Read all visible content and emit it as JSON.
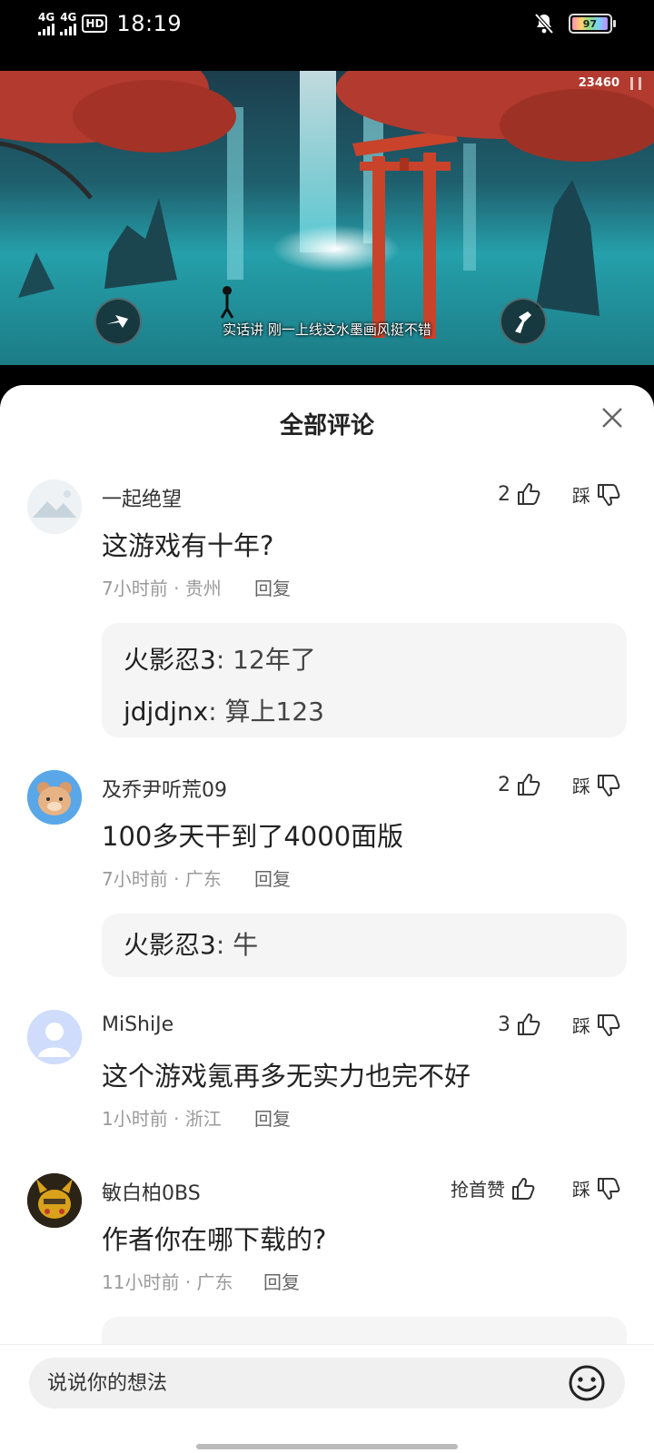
{
  "status_bar": {
    "signal1": "4G",
    "signal2": "4G",
    "hd": "HD",
    "time": "18:19",
    "battery": "97"
  },
  "video": {
    "score": "23460",
    "subtitle": "实话讲 刚一上线这水墨画风挺不错"
  },
  "sheet": {
    "title": "全部评论"
  },
  "comments": [
    {
      "user": "一起绝望",
      "text": "这游戏有十年?",
      "time": "7小时前",
      "location": "贵州",
      "reply_label": "回复",
      "likes": "2",
      "dislike_label": "踩",
      "replies": [
        {
          "user": "火影忍3",
          "text": "12年了"
        },
        {
          "user": "jdjdjnx",
          "text": "算上123"
        }
      ]
    },
    {
      "user": "及乔尹听荒09",
      "text": "100多天干到了4000面版",
      "time": "7小时前",
      "location": "广东",
      "reply_label": "回复",
      "likes": "2",
      "dislike_label": "踩",
      "replies": [
        {
          "user": "火影忍3",
          "text": "牛"
        }
      ]
    },
    {
      "user": "MiShiJe",
      "text": "这个游戏氪再多无实力也完不好",
      "time": "1小时前",
      "location": "浙江",
      "reply_label": "回复",
      "likes": "3",
      "dislike_label": "踩"
    },
    {
      "user": "敏白柏0BS",
      "text": "作者你在哪下载的?",
      "time": "11小时前",
      "location": "广东",
      "reply_label": "回复",
      "likes": "抢首赞",
      "dislike_label": "踩"
    }
  ],
  "input": {
    "placeholder": "说说你的想法"
  }
}
